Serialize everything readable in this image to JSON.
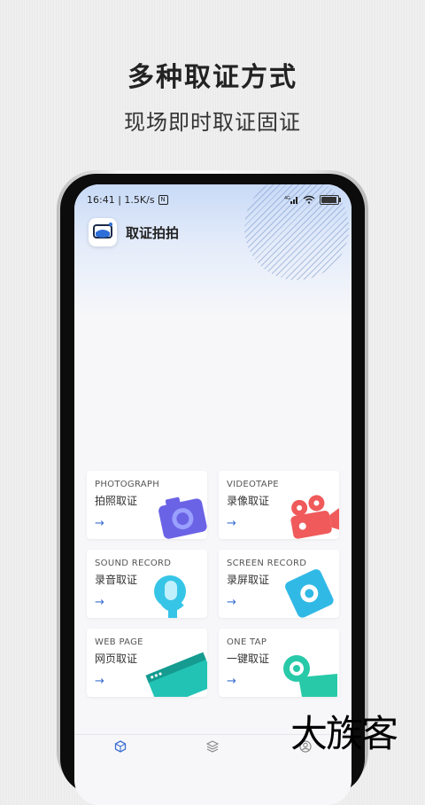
{
  "hero": {
    "title": "多种取证方式",
    "subtitle": "现场即时取证固证"
  },
  "status_bar": {
    "time_speed": "16:41 | 1.5K/s",
    "nfc_glyph": "N",
    "signal_text": "4G",
    "battery_text": "100"
  },
  "app": {
    "title": "取证拍拍"
  },
  "cards": [
    {
      "en": "PHOTOGRAPH",
      "cn": "拍照取证",
      "arrow": "→",
      "icon": "camera-icon",
      "color": "#6b63e6"
    },
    {
      "en": "VIDEOTAPE",
      "cn": "录像取证",
      "arrow": "→",
      "icon": "video-camera-icon",
      "color": "#f05a5a"
    },
    {
      "en": "SOUND RECORD",
      "cn": "录音取证",
      "arrow": "→",
      "icon": "microphone-icon",
      "color": "#36c5e6"
    },
    {
      "en": "SCREEN RECORD",
      "cn": "录屏取证",
      "arrow": "→",
      "icon": "screen-record-icon",
      "color": "#31b9e6"
    },
    {
      "en": "WEB PAGE",
      "cn": "网页取证",
      "arrow": "→",
      "icon": "browser-icon",
      "color": "#22c3b5"
    },
    {
      "en": "ONE TAP",
      "cn": "一键取证",
      "arrow": "→",
      "icon": "tap-icon",
      "color": "#28c9a8"
    }
  ],
  "bottom_nav": [
    "cube-icon",
    "layers-icon",
    "profile-icon"
  ],
  "watermark": "大族客"
}
